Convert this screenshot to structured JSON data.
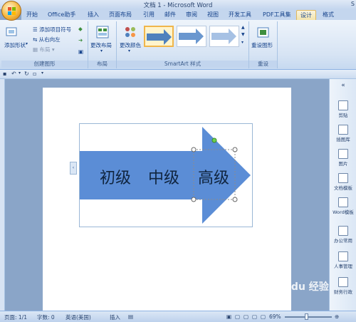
{
  "title_bar": {
    "window_title": "文档 1 - Microsoft Word",
    "qat_hint": "",
    "right_label": "S"
  },
  "tabs": [
    {
      "label": "开始"
    },
    {
      "label": "Office助手"
    },
    {
      "label": "插入"
    },
    {
      "label": "页面布局"
    },
    {
      "label": "引用"
    },
    {
      "label": "邮件"
    },
    {
      "label": "审阅"
    },
    {
      "label": "视图"
    },
    {
      "label": "开发工具"
    },
    {
      "label": "PDF工具集"
    },
    {
      "label": "设计"
    },
    {
      "label": "格式"
    }
  ],
  "ribbon": {
    "create_graphic": {
      "label": "创建图形",
      "add_shape": "添加形状",
      "add_bullet": "添加项目符号",
      "right_to_left": "从右向左",
      "layout": "布局"
    },
    "layouts": {
      "label": "布局",
      "change_layout": "更改布局"
    },
    "smartart_styles": {
      "label": "SmartArt 样式",
      "change_colors": "更改颜色"
    },
    "reset": {
      "label": "重设",
      "reset_graphic": "重设图形"
    }
  },
  "smartart": {
    "items": [
      "初级",
      "中级",
      "高级"
    ],
    "fill_color": "#5b8dd6",
    "accent_color": "#4f81bd"
  },
  "right_panel": {
    "items": [
      "剪贴",
      "图片",
      "插图库",
      "图片",
      "文档模板",
      "Word模板",
      "办公常用",
      "人事管理",
      "财务行政"
    ]
  },
  "status": {
    "page": "页面: 1/1",
    "words": "字数: 0",
    "language": "英语(美国)",
    "insert": "插入",
    "zoom": "69%"
  },
  "watermark": "Baidu 经验"
}
